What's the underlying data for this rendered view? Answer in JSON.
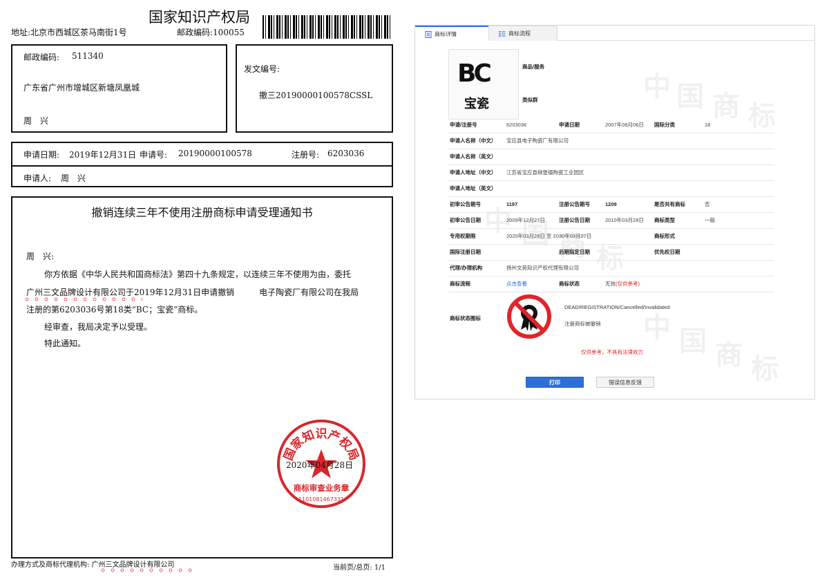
{
  "notice": {
    "office_name": "国家知识产权局",
    "office_address": "地址:北京市西城区茶马南街1号",
    "office_postcode": "邮政编码:100055",
    "recipient": {
      "postcode_label": "邮政编码:",
      "postcode_value": "511340",
      "address": "广东省广州市增城区新塘凤凰城",
      "name": "周　兴"
    },
    "dispatch": {
      "label": "发文编号:",
      "number": "撤三20190000100578CSSL"
    },
    "application": {
      "date_label": "申请日期:",
      "date_value": "2019年12月31日",
      "no_label": "申请号:",
      "no_value": "20190000100578",
      "reg_label": "注册号:",
      "reg_value": "6203036",
      "applicant_label": "申请人:",
      "applicant_value": "周　兴"
    },
    "title": "撤销连续三年不使用注册商标申请受理通知书",
    "salutation": "周　兴:",
    "body_line1": "你方依据《中华人民共和国商标法》第四十九条规定，以连续三年不使用为由，委托",
    "body_line2": "广州三文品牌设计有限公司于2019年12月31日申请撤销　　　电子陶瓷厂有限公司在我局",
    "body_line3": "注册的第6203036号第18类“BC；宝瓷”商标。",
    "body_line4": "经审查，我局决定予以受理。",
    "body_line5": "特此通知。",
    "date": "2020年04月28日",
    "seal": {
      "top_text": "国家知识产权局",
      "bottom_text": "商标审查业务章",
      "code": "1101081467331"
    },
    "footer_agent": "办理方式及商标代理机构: 广州三文品牌设计有限公司",
    "footer_page": "当前页/总页: 1/1"
  },
  "detail": {
    "tabs": [
      {
        "label": "商标详情",
        "icon": "document-icon"
      },
      {
        "label": "商标流程",
        "icon": "list-icon"
      }
    ],
    "logo": {
      "mark": "BC",
      "text": "宝瓷"
    },
    "goods_label": "商品/服务",
    "similar_label": "类似群",
    "rows": {
      "reg_no_label": "申请/注册号",
      "reg_no_value": "6203036",
      "apply_date_label": "申请日期",
      "apply_date_value": "2007年08月06日",
      "intl_class_label": "国际分类",
      "intl_class_value": "18",
      "applicant_cn_label": "申请人名称（中文）",
      "applicant_cn_value": "宝应县电子陶瓷厂有限公司",
      "applicant_en_label": "申请人名称（英文）",
      "address_cn_label": "申请人地址（中文）",
      "address_cn_value": "江苏省宝应县柳堡镇陶瓷工业园区",
      "address_en_label": "申请人地址（英文）",
      "prelim_no_label": "初审公告期号",
      "prelim_no_value": "1197",
      "reg_pub_no_label": "注册公告期号",
      "reg_pub_no_value": "1209",
      "shared_label": "是否共有商标",
      "shared_value": "否",
      "prelim_date_label": "初审公告日期",
      "prelim_date_value": "2009年12月27日",
      "reg_pub_date_label": "注册公告日期",
      "reg_pub_date_value": "2010年03月28日",
      "mark_type_label": "商标类型",
      "mark_type_value": "一般",
      "right_term_label": "专用权期限",
      "right_term_value": "2020年03月28日 至 2030年03月27日",
      "mark_form_label": "商标形式",
      "intl_reg_date_label": "国际注册日期",
      "later_date_label": "后期指定日期",
      "priority_date_label": "优先权日期",
      "agent_label": "代理/办理机构",
      "agent_value": "扬州文苑知识产权代理有限公司",
      "process_label": "商标流程",
      "process_link": "点击查看",
      "status_label": "商标状态",
      "status_value": "无效",
      "status_note": "(仅供参考)",
      "status_icon_label": "商标状态图标",
      "status_en": "DEAD/REGISTRATION/Cancelled/Invalidated",
      "status_cn": "注册商标被撤销"
    },
    "disclaimer": "仅供参考，不具有法律效力",
    "print_button": "打印",
    "feedback_button": "错误信息反馈",
    "watermark_chars": [
      "中",
      "国",
      "商",
      "标"
    ],
    "colors": {
      "accent": "#2d6fd6",
      "link": "#1a6fd8",
      "warning": "#e0252a",
      "seal": "#d8262a"
    }
  }
}
